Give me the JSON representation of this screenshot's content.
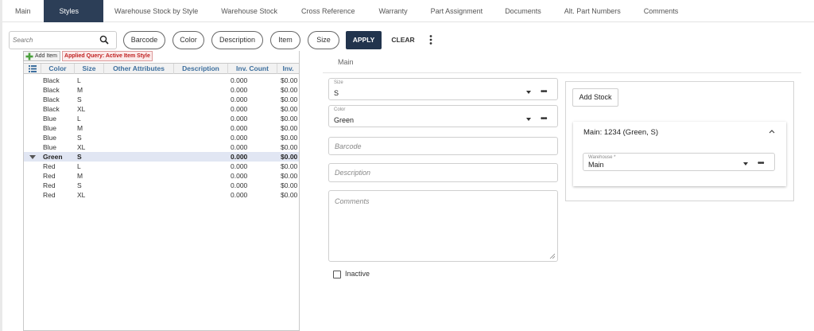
{
  "tabs": [
    {
      "label": "Main",
      "active": false
    },
    {
      "label": "Styles",
      "active": true
    },
    {
      "label": "Warehouse Stock by Style",
      "active": false
    },
    {
      "label": "Warehouse Stock",
      "active": false
    },
    {
      "label": "Cross Reference",
      "active": false
    },
    {
      "label": "Warranty",
      "active": false
    },
    {
      "label": "Part Assignment",
      "active": false
    },
    {
      "label": "Documents",
      "active": false
    },
    {
      "label": "Alt. Part Numbers",
      "active": false
    },
    {
      "label": "Comments",
      "active": false
    }
  ],
  "toolbar": {
    "search_placeholder": "Search",
    "filters": [
      "Barcode",
      "Color",
      "Description",
      "Item",
      "Size"
    ],
    "apply_label": "APPLY",
    "clear_label": "CLEAR"
  },
  "grid": {
    "add_item_label": "Add Item",
    "applied_query": "Applied Query: Active Item Style",
    "columns": [
      "Color",
      "Size",
      "Other Attributes",
      "Description",
      "Inv. Count",
      "Inv."
    ],
    "rows": [
      {
        "color": "Black",
        "size": "L",
        "count": "0.000",
        "inv": "$0.00",
        "selected": false
      },
      {
        "color": "Black",
        "size": "M",
        "count": "0.000",
        "inv": "$0.00",
        "selected": false
      },
      {
        "color": "Black",
        "size": "S",
        "count": "0.000",
        "inv": "$0.00",
        "selected": false
      },
      {
        "color": "Black",
        "size": "XL",
        "count": "0.000",
        "inv": "$0.00",
        "selected": false
      },
      {
        "color": "Blue",
        "size": "L",
        "count": "0.000",
        "inv": "$0.00",
        "selected": false
      },
      {
        "color": "Blue",
        "size": "M",
        "count": "0.000",
        "inv": "$0.00",
        "selected": false
      },
      {
        "color": "Blue",
        "size": "S",
        "count": "0.000",
        "inv": "$0.00",
        "selected": false
      },
      {
        "color": "Blue",
        "size": "XL",
        "count": "0.000",
        "inv": "$0.00",
        "selected": false
      },
      {
        "color": "Green",
        "size": "S",
        "count": "0.000",
        "inv": "$0.00",
        "selected": true
      },
      {
        "color": "Red",
        "size": "L",
        "count": "0.000",
        "inv": "$0.00",
        "selected": false
      },
      {
        "color": "Red",
        "size": "M",
        "count": "0.000",
        "inv": "$0.00",
        "selected": false
      },
      {
        "color": "Red",
        "size": "S",
        "count": "0.000",
        "inv": "$0.00",
        "selected": false
      },
      {
        "color": "Red",
        "size": "XL",
        "count": "0.000",
        "inv": "$0.00",
        "selected": false
      }
    ]
  },
  "form": {
    "section_label": "Main",
    "size_label": "Size",
    "size_value": "S",
    "color_label": "Color",
    "color_value": "Green",
    "barcode_placeholder": "Barcode",
    "description_placeholder": "Description",
    "comments_placeholder": "Comments",
    "inactive_label": "Inactive"
  },
  "stock": {
    "add_stock_label": "Add Stock",
    "card_title": "Main: 1234 (Green, S)",
    "warehouse_label": "Warehouse *",
    "warehouse_value": "Main"
  },
  "colors": {
    "active_tab": "#2c3e57",
    "apply_button": "#22344d",
    "header_text": "#3d6f9e",
    "selected_row": "#e1e6f3",
    "query_text": "#c02020"
  }
}
